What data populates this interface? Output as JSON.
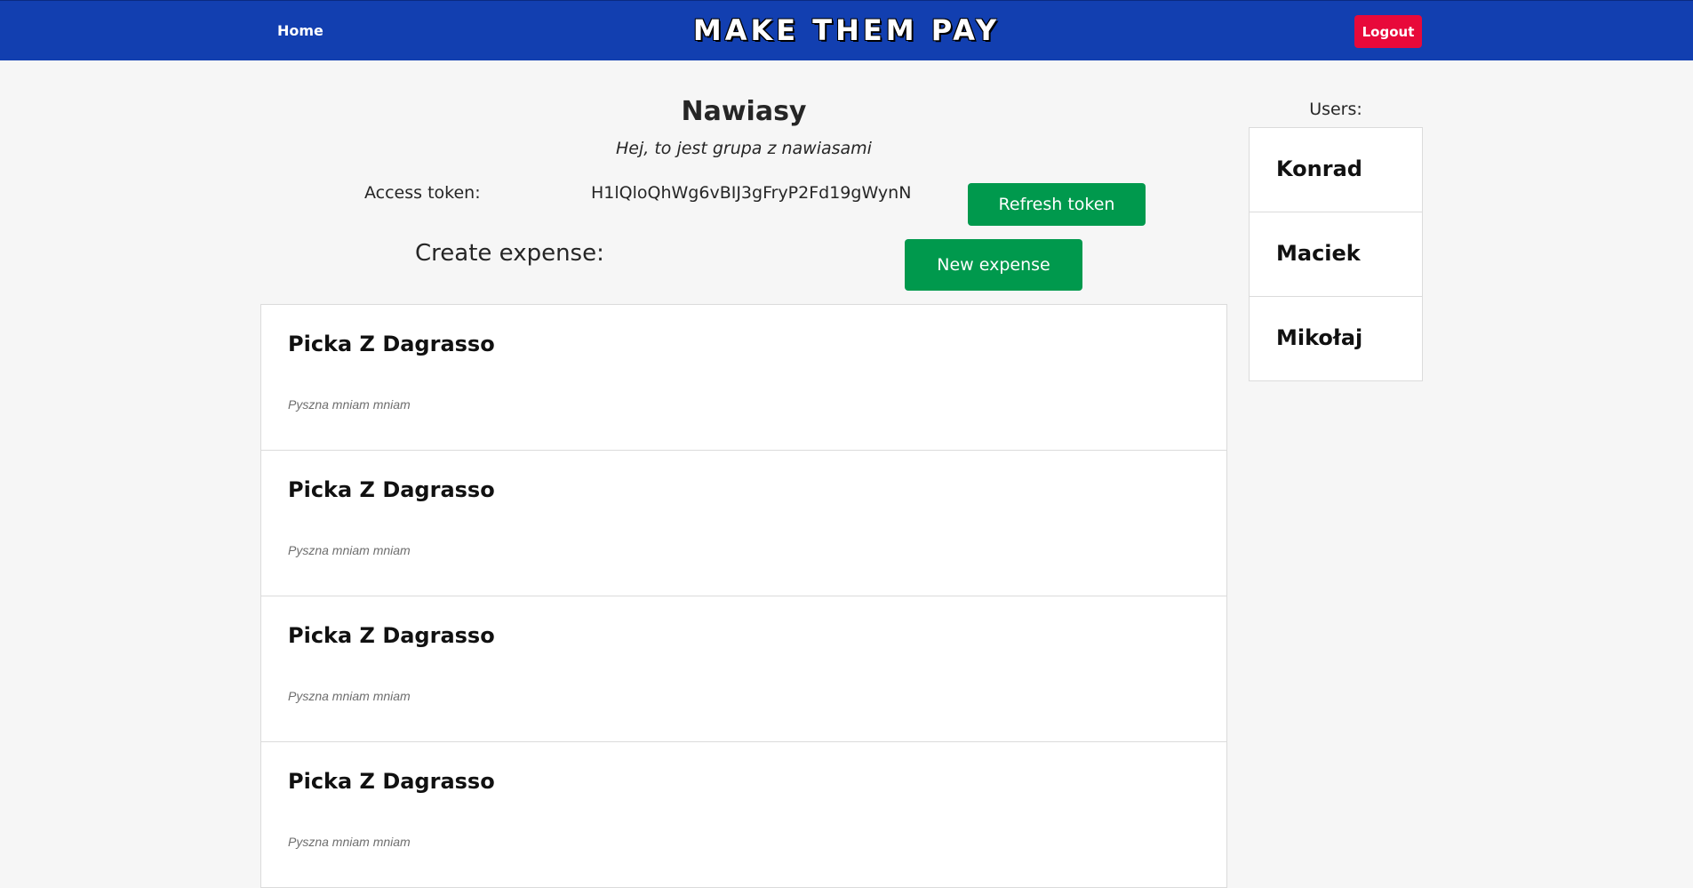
{
  "navbar": {
    "home_label": "Home",
    "brand": "MAKE THEM PAY",
    "logout_label": "Logout",
    "background_color": "#123fb0",
    "logout_color": "#e8093a"
  },
  "group": {
    "name": "Nawiasy",
    "description": "Hej, to jest grupa z nawiasami"
  },
  "token": {
    "label": "Access token:",
    "value": "H1lQloQhWg6vBIJ3gFryP2Fd19gWynN",
    "refresh_label": "Refresh token"
  },
  "create": {
    "label": "Create expense:",
    "button_label": "New expense",
    "button_color": "#00994d"
  },
  "expenses": [
    {
      "title": "Picka Z Dagrasso",
      "description": "Pyszna mniam mniam"
    },
    {
      "title": "Picka Z Dagrasso",
      "description": "Pyszna mniam mniam"
    },
    {
      "title": "Picka Z Dagrasso",
      "description": "Pyszna mniam mniam"
    },
    {
      "title": "Picka Z Dagrasso",
      "description": "Pyszna mniam mniam"
    }
  ],
  "users": {
    "heading": "Users:",
    "items": [
      {
        "name": "Konrad"
      },
      {
        "name": "Maciek"
      },
      {
        "name": "Mikołaj"
      }
    ]
  }
}
